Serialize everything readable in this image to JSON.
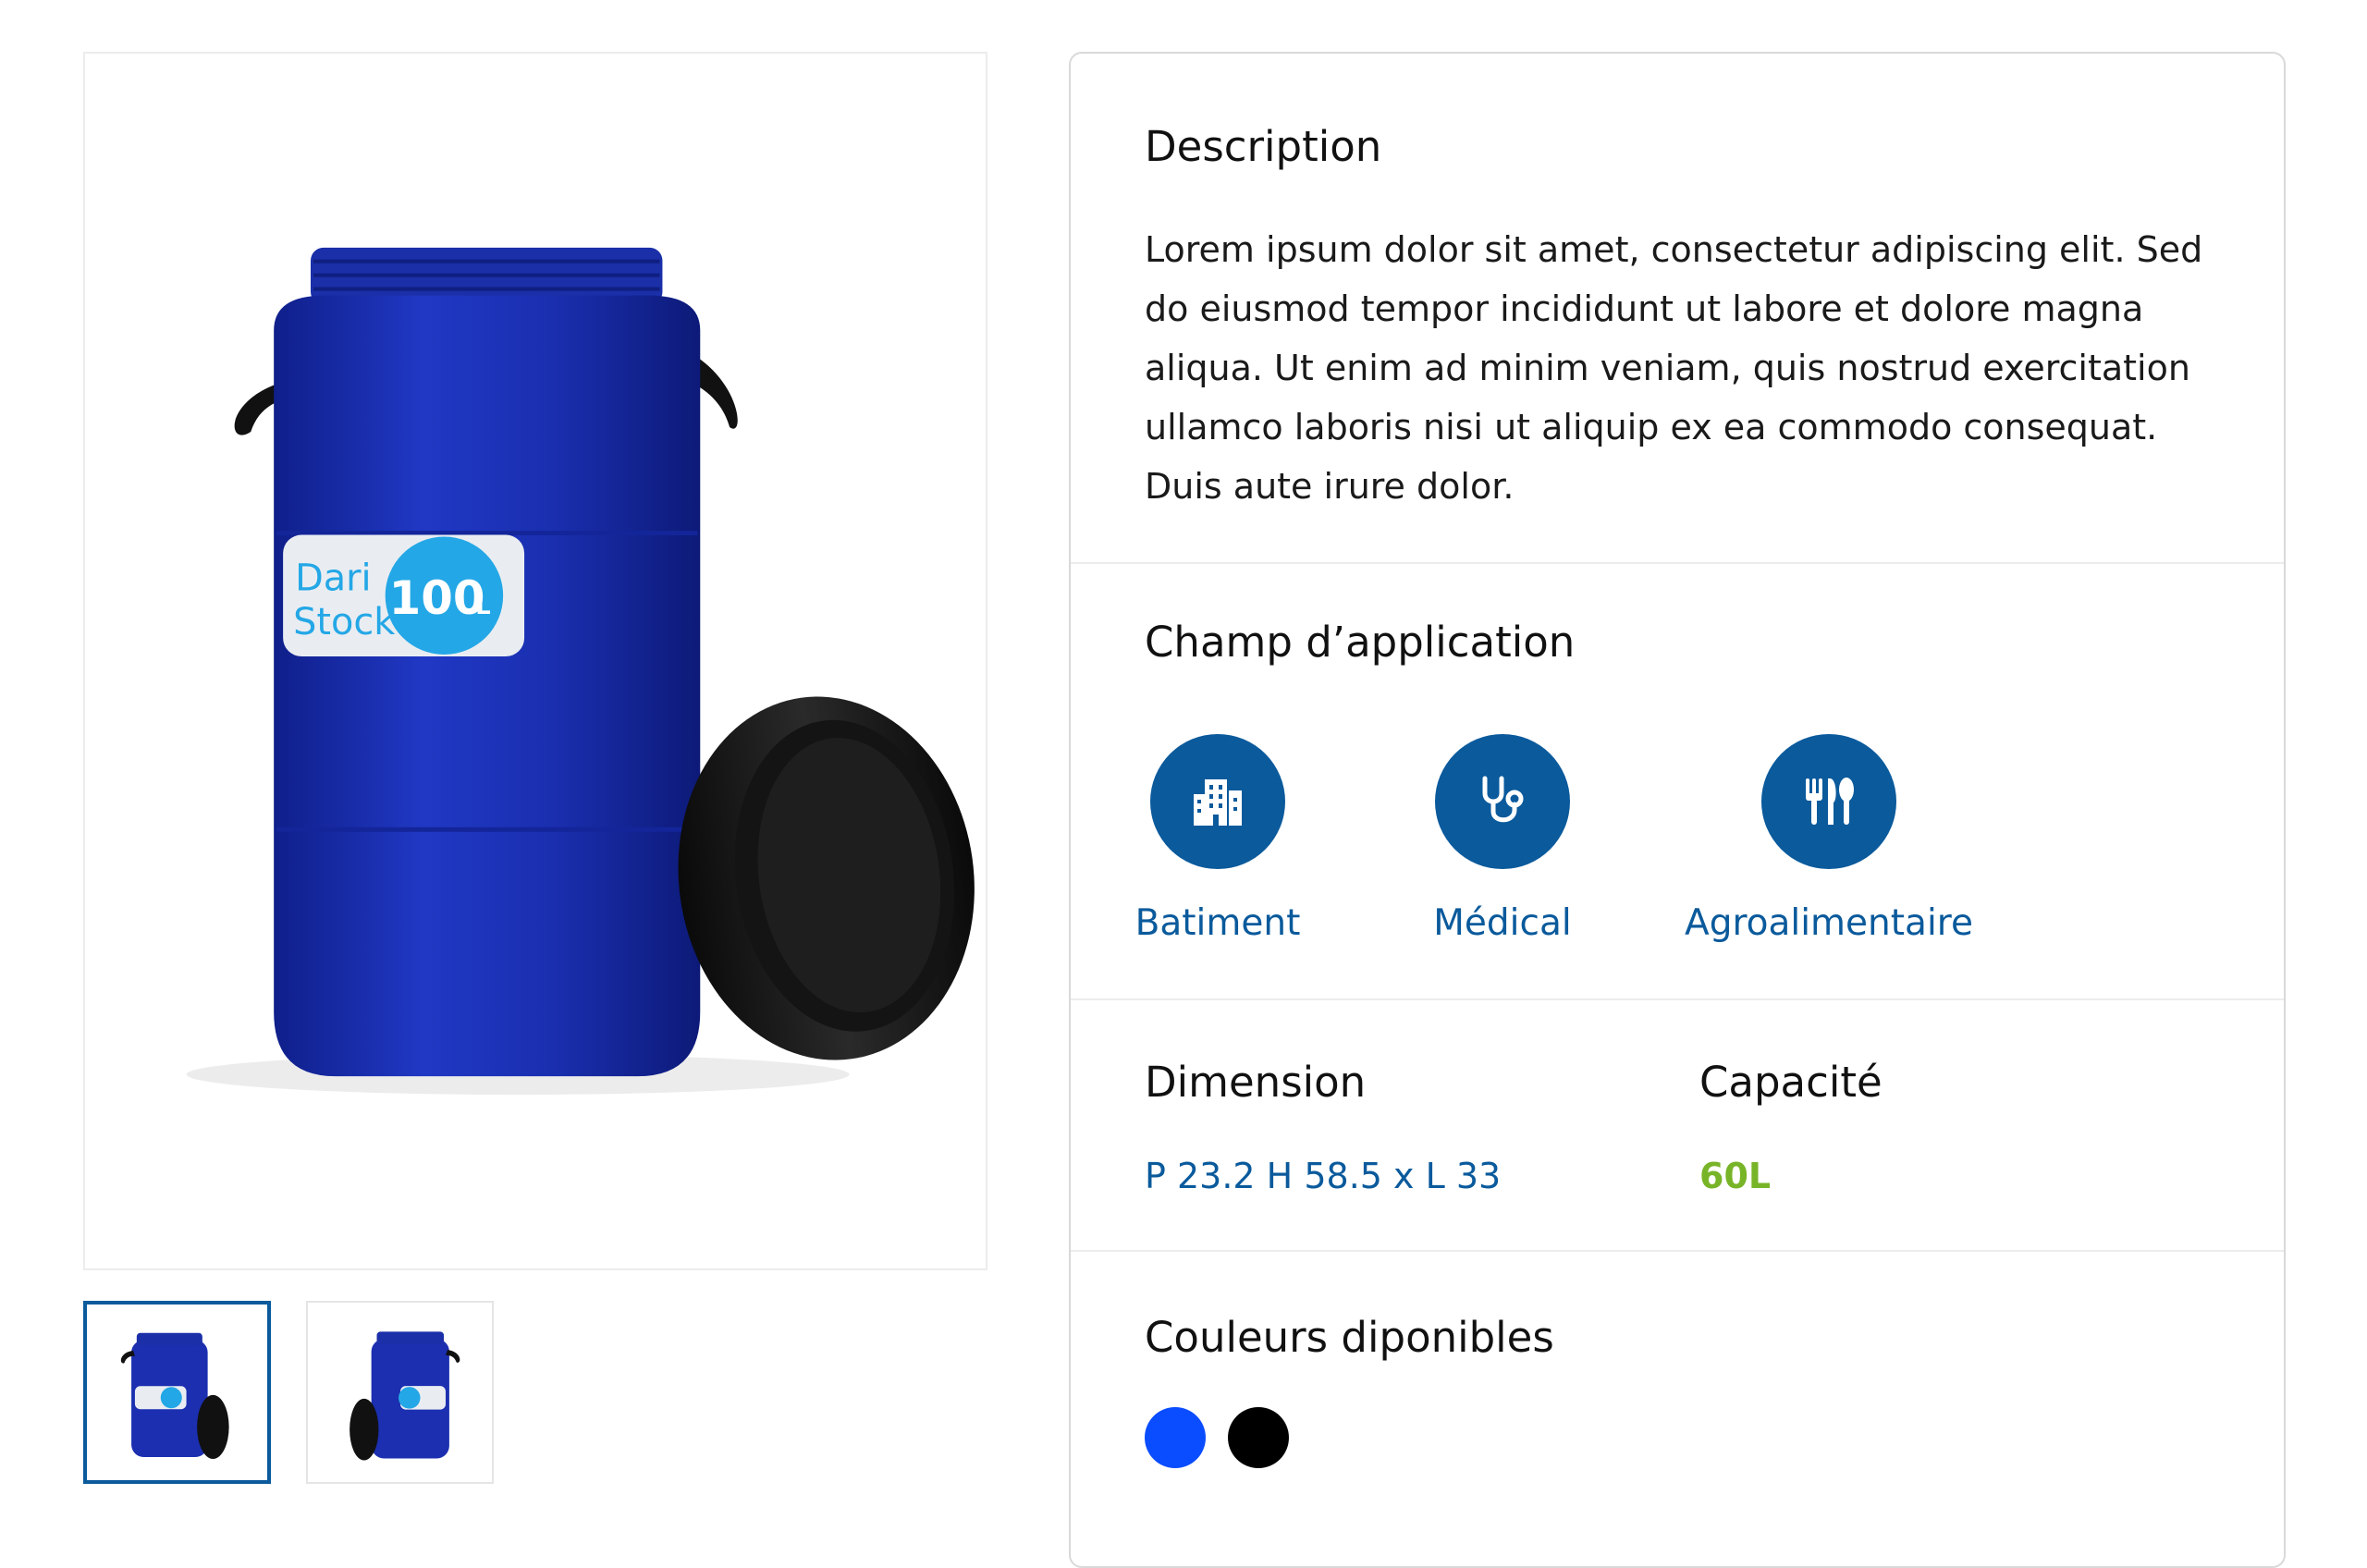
{
  "product": {
    "image_alt": "Blue plastic drum with black lid",
    "label_brand_line1": "Dari",
    "label_brand_line2": "Stock",
    "label_capacity": "100",
    "label_unit": "L"
  },
  "thumbnails": [
    {
      "label": "Front view with lid"
    },
    {
      "label": "Side view"
    }
  ],
  "description": {
    "title": "Description",
    "text": "Lorem ipsum dolor sit amet, consectetur adipiscing elit. Sed do eiusmod tempor incididunt ut labore et dolore magna aliqua. Ut enim ad minim veniam, quis nostrud exercitation ullamco laboris nisi ut aliquip ex ea commodo consequat. Duis aute irure dolor."
  },
  "application": {
    "title": "Champ d’application",
    "items": [
      {
        "label": "Batiment",
        "icon": "building-icon"
      },
      {
        "label": "Médical",
        "icon": "stethoscope-icon"
      },
      {
        "label": "Agroalimentaire",
        "icon": "cutlery-icon"
      }
    ]
  },
  "specs": {
    "dimension_title": "Dimension",
    "dimension_value": "P 23.2 H 58.5 x L 33",
    "capacity_title": "Capacité",
    "capacity_value": "60L"
  },
  "colors": {
    "title": "Couleurs diponibles",
    "swatches": [
      "#0a4cff",
      "#000000"
    ]
  },
  "theme": {
    "accent": "#0a5a9c",
    "capacity_color": "#78b428",
    "drum_blue": "#1b2fb0"
  }
}
